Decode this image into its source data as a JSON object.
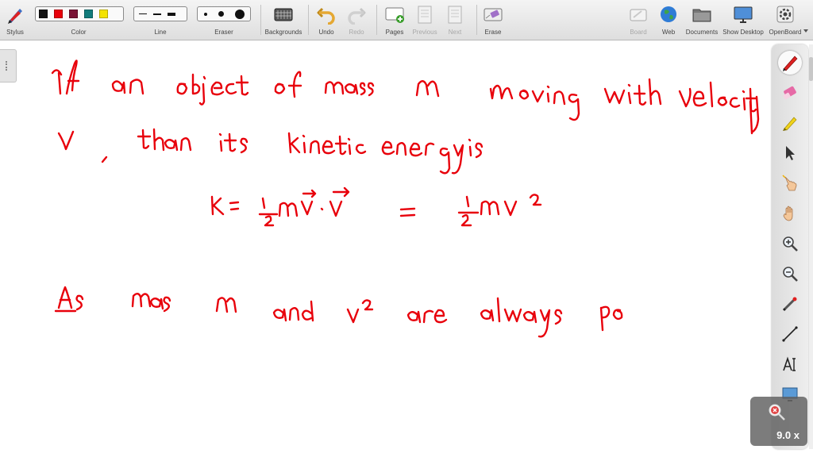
{
  "app": "OpenBoard",
  "toolbar": {
    "stylus": "Stylus",
    "color": "Color",
    "line": "Line",
    "eraser": "Eraser",
    "backgrounds": "Backgrounds",
    "undo": "Undo",
    "redo": "Redo",
    "pages": "Pages",
    "previous": "Previous",
    "next": "Next",
    "erase": "Erase",
    "board": "Board",
    "web": "Web",
    "documents": "Documents",
    "show_desktop": "Show Desktop",
    "openboard": "OpenBoard"
  },
  "palette_colors": [
    "#111111",
    "#e8000b",
    "#7a1436",
    "#117b7b",
    "#f4e300"
  ],
  "ink_color": "#e8000b",
  "zoom": "9.0 x"
}
